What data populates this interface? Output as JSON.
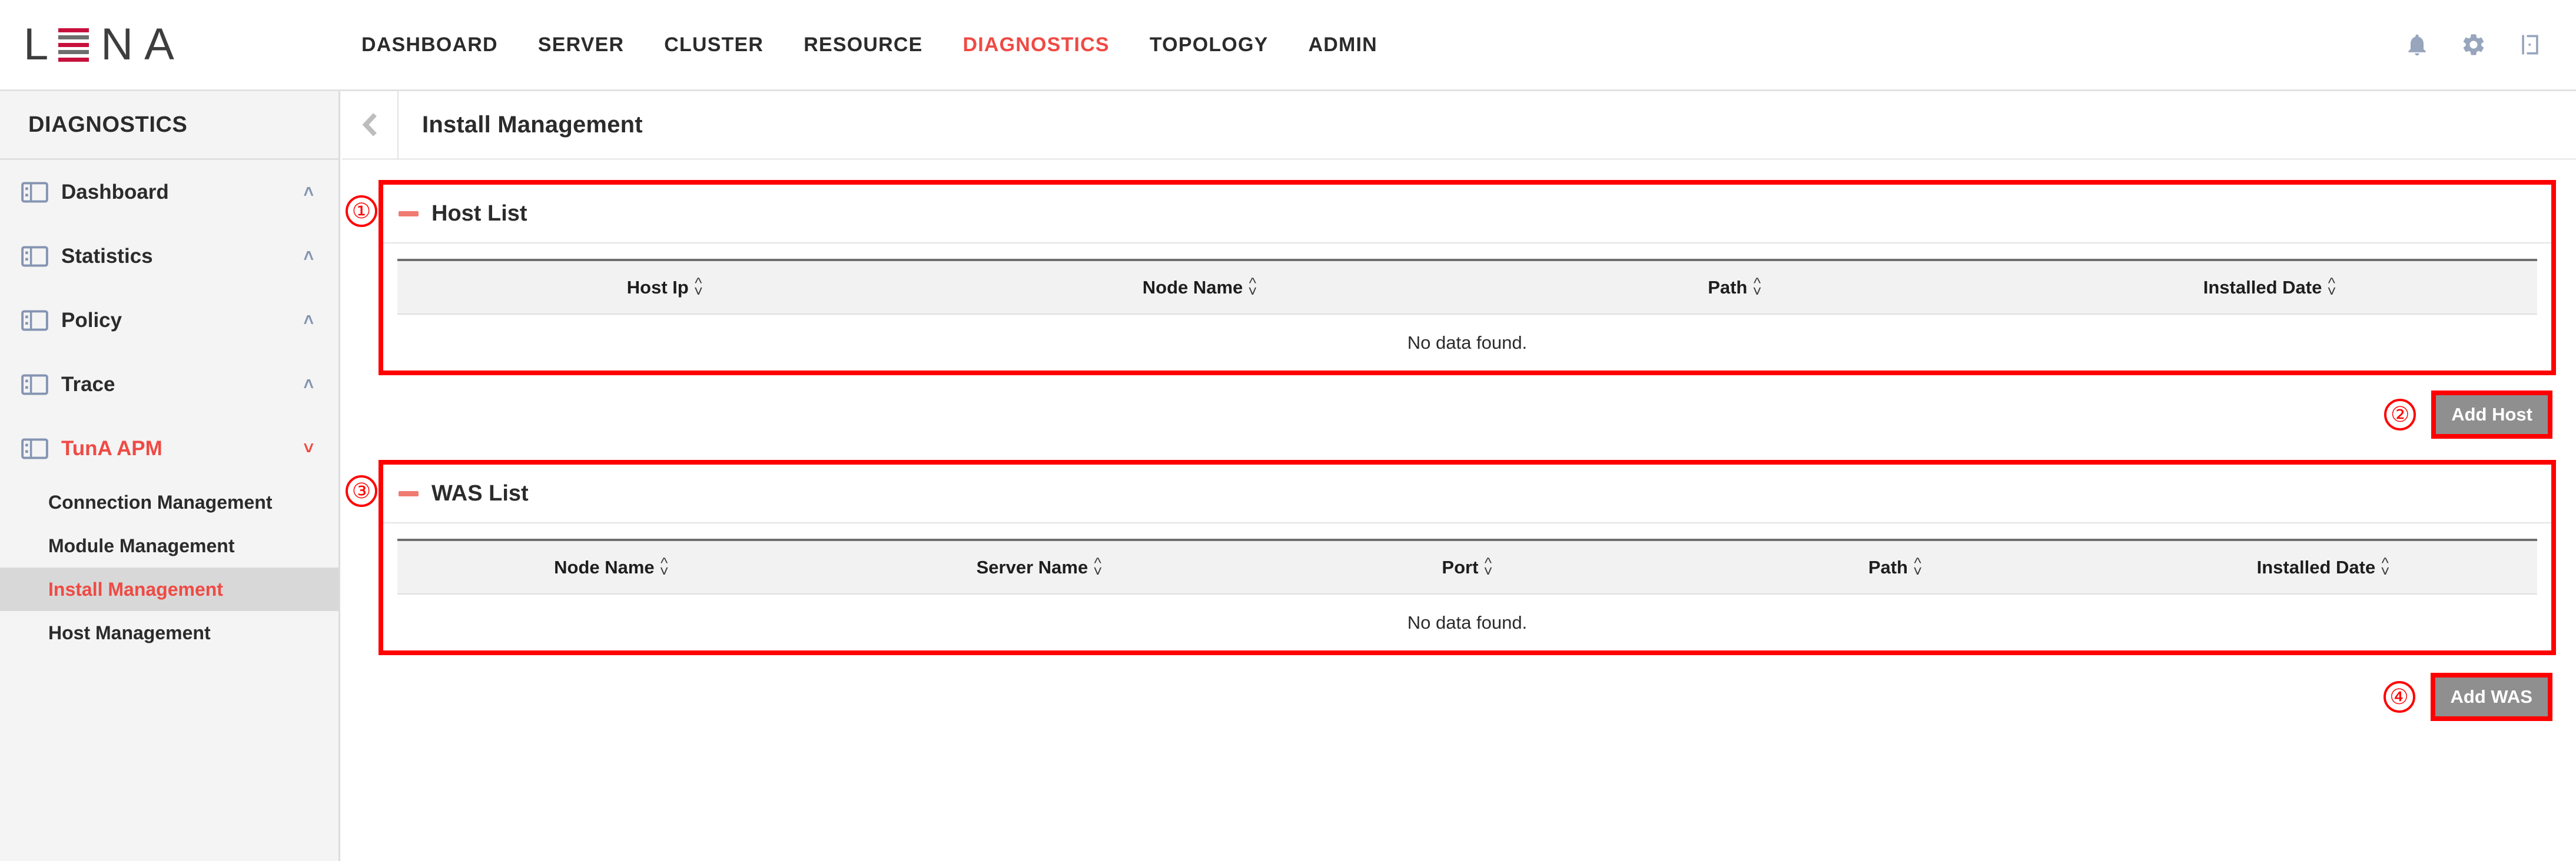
{
  "brand": {
    "letter_l": "L",
    "letter_na": "N A"
  },
  "topnav": {
    "items": [
      {
        "label": "DASHBOARD",
        "active": false
      },
      {
        "label": "SERVER",
        "active": false
      },
      {
        "label": "CLUSTER",
        "active": false
      },
      {
        "label": "RESOURCE",
        "active": false
      },
      {
        "label": "DIAGNOSTICS",
        "active": true
      },
      {
        "label": "TOPOLOGY",
        "active": false
      },
      {
        "label": "ADMIN",
        "active": false
      }
    ],
    "icons": [
      {
        "name": "bell-icon"
      },
      {
        "name": "gear-icon"
      },
      {
        "name": "logout-icon"
      }
    ]
  },
  "sidebar": {
    "title": "DIAGNOSTICS",
    "items": [
      {
        "label": "Dashboard",
        "chevron": "˄",
        "active": false
      },
      {
        "label": "Statistics",
        "chevron": "˄",
        "active": false
      },
      {
        "label": "Policy",
        "chevron": "˄",
        "active": false
      },
      {
        "label": "Trace",
        "chevron": "˄",
        "active": false
      },
      {
        "label": "TunA APM",
        "chevron": "˅",
        "active": true
      }
    ],
    "subitems": [
      {
        "label": "Connection Management",
        "selected": false
      },
      {
        "label": "Module Management",
        "selected": false
      },
      {
        "label": "Install Management",
        "selected": true
      },
      {
        "label": "Host Management",
        "selected": false
      }
    ]
  },
  "breadcrumb": {
    "back_icon": "chevron-left-icon",
    "title": "Install Management"
  },
  "host_panel": {
    "annotation": "①",
    "collapse_toggle": "minus",
    "title": "Host List",
    "columns": [
      "Host Ip",
      "Node Name",
      "Path",
      "Installed Date"
    ],
    "empty_text": "No data found.",
    "rows": []
  },
  "add_host": {
    "annotation": "②",
    "label": "Add Host"
  },
  "was_panel": {
    "annotation": "③",
    "collapse_toggle": "minus",
    "title": "WAS List",
    "columns": [
      "Node Name",
      "Server Name",
      "Port",
      "Path",
      "Installed Date"
    ],
    "empty_text": "No data found.",
    "rows": []
  },
  "add_was": {
    "annotation": "④",
    "label": "Add WAS"
  },
  "colors": {
    "accent_red": "#ef4a44",
    "brand_red": "#c8103c",
    "annotation_red": "#ff0000",
    "button_gray": "#8f8f8f",
    "icon_blue_gray": "#97a5bd"
  }
}
